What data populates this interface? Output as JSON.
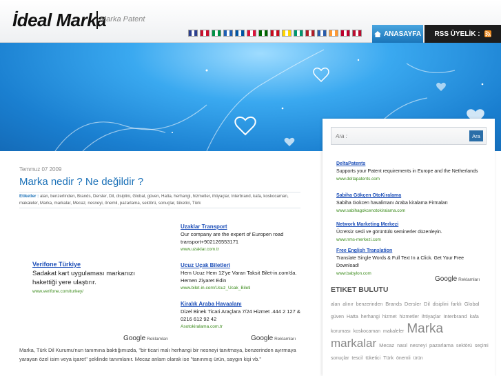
{
  "header": {
    "logo": "İdeal Marka",
    "tagline": "Marka Patent",
    "flags": [
      {
        "name": "uk-flag",
        "color": "#2b3f8f"
      },
      {
        "name": "de-flag",
        "color": "#c8102e"
      },
      {
        "name": "it-flag",
        "color": "#009246"
      },
      {
        "name": "gr-flag",
        "color": "#1e5fb4"
      },
      {
        "name": "fr-flag",
        "color": "#0055a4"
      },
      {
        "name": "pl-flag",
        "color": "#dc143c"
      },
      {
        "name": "pt-flag",
        "color": "#006600"
      },
      {
        "name": "es-flag",
        "color": "#c60b1e"
      },
      {
        "name": "ua-flag",
        "color": "#ffd500"
      },
      {
        "name": "bg-flag",
        "color": "#00966e"
      },
      {
        "name": "nl-flag",
        "color": "#ae1c28"
      },
      {
        "name": "fi-flag",
        "color": "#2a5cab"
      },
      {
        "name": "in-flag",
        "color": "#ff9933"
      },
      {
        "name": "jp-flag",
        "color": "#bc002d"
      },
      {
        "name": "no-flag",
        "color": "#ba0c2f"
      }
    ],
    "nav_home": "ANASAYFA",
    "nav_rss": "RSS ÜYELİK :"
  },
  "post": {
    "date": "Temmuz 07 2009",
    "title": "Marka nedir ? Ne değildir ?",
    "tags_label": "Etiketler :",
    "tags_text": "alan, benzerlinden, Brands, Dersler, Dil, disiplini, Global, güven, Hatta, herhangi, hizmetler, ihtiyaçlar, Interbrand, kafa, koskocaman, makaleler, Marka, markalar, Mecaz, nesneyi, önemli, pazarlama, sektörü, sonuçlar, tüketici, Türk",
    "body": "Marka, Türk Dil Kurumu'nun tanımına baktığımızda, \"bir ticari malı herhangi bir nesneyi tanıtmaya, benzerinden ayırmaya yarayan özel isim veya işaret\" şeklinde tanımlanır. Mecaz anlam olarak ise \"tanınmış ürün, saygın kişi vb.\""
  },
  "ads_left": {
    "big": {
      "title": "Verifone Türkiye",
      "text": "Sadakat kart uygulaması markanızı hakettiği yere ulaştırır.",
      "url": "www.verifone.com/turkey/"
    }
  },
  "ads_right": [
    {
      "title": "Uzaklar Transport",
      "text": "Our company are the expert of Europen road transport+902126553171",
      "url": "www.uzaklar.com.tr"
    },
    {
      "title": "Ucuz Uçak Biletleri",
      "text": "Hem Ucuz Hem 12'ye Varan Taksit Bilet-in.com'da. Hemen Ziyaret Edin",
      "url": "www.bilet-in.com/Ucuz_Ucak_Bileti"
    },
    {
      "title": "Kiralık Araba Havaalanı",
      "text": "Dizel Binek Ticari Araçlara 7/24 Hizmet .444 2 127 & 0216 612 92 42",
      "url": "Asotokiralama.com.tr"
    }
  ],
  "google_label": "Google",
  "reklam_label": "Reklamları",
  "sidebar": {
    "search_placeholder": "Ara :",
    "search_button": "Ara",
    "ads": [
      {
        "title": "DeltaPatents",
        "text": "Supports your Patent requirements in Europe and the Netherlands",
        "url": "www.deltapatents.com"
      },
      {
        "title": "Sabiha Gökçen OtoKiralama",
        "text": "Sabiha Gokcen havalimanı Araba kiralama Firmaları",
        "url": "www.sabihagokcenotokiralama.com"
      },
      {
        "title": "Network Marketing Merkezi",
        "text": "Ücretsiz sesli ve görüntülü seminerler düzenleyin.",
        "url": "www.nms-merkezi.com"
      },
      {
        "title": "Free English Translation",
        "text": "Translate Single Words & Full Text In a Click. Get Your Free Download!",
        "url": "www.babylon.com"
      }
    ],
    "tag_title": "ETIKET BULUTU",
    "tags": [
      {
        "t": "alan",
        "s": 7
      },
      {
        "t": "alınır",
        "s": 7
      },
      {
        "t": "benzerinden",
        "s": 7
      },
      {
        "t": "Brands",
        "s": 7.5
      },
      {
        "t": "Dersler",
        "s": 7.5
      },
      {
        "t": "Dil",
        "s": 7.5
      },
      {
        "t": "disiplini",
        "s": 7
      },
      {
        "t": "farklı",
        "s": 7
      },
      {
        "t": "Global",
        "s": 7.5
      },
      {
        "t": "güven",
        "s": 7
      },
      {
        "t": "Hatta",
        "s": 7
      },
      {
        "t": "herhangi",
        "s": 7
      },
      {
        "t": "hizmet",
        "s": 7
      },
      {
        "t": "hizmetler",
        "s": 7
      },
      {
        "t": "ihtiyaçlar",
        "s": 7
      },
      {
        "t": "Interbrand",
        "s": 7.5
      },
      {
        "t": "kafa",
        "s": 7
      },
      {
        "t": "koruması",
        "s": 7
      },
      {
        "t": "koskocaman",
        "s": 7
      },
      {
        "t": "makaleler",
        "s": 7
      },
      {
        "t": "Marka",
        "s": 19
      },
      {
        "t": "markalar",
        "s": 17
      },
      {
        "t": "Mecaz",
        "s": 7.5
      },
      {
        "t": "nasıl",
        "s": 7
      },
      {
        "t": "nesneyi",
        "s": 7
      },
      {
        "t": "pazarlama",
        "s": 7.5
      },
      {
        "t": "sektörü",
        "s": 7
      },
      {
        "t": "seçimi",
        "s": 7
      },
      {
        "t": "sonuçlar",
        "s": 7
      },
      {
        "t": "tescil",
        "s": 7
      },
      {
        "t": "tüketici",
        "s": 7
      },
      {
        "t": "Türk",
        "s": 7.5
      },
      {
        "t": "önemli",
        "s": 7
      },
      {
        "t": "ürün",
        "s": 7
      }
    ]
  },
  "colors": {
    "link": "#1d72b8",
    "ad_link": "#1d4fb8",
    "ad_url": "#3a8a1a",
    "banner": "#1a7fd0"
  }
}
